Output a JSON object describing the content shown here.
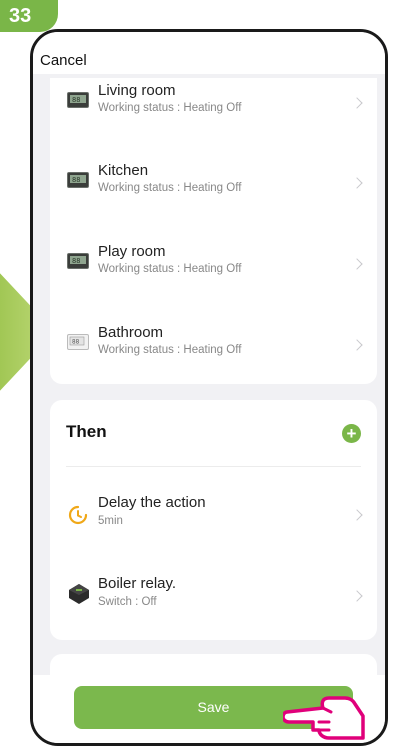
{
  "step_badge": "33",
  "header": {
    "cancel_label": "Cancel"
  },
  "if_devices": [
    {
      "name": "Living room",
      "status": "Working status : Heating Off",
      "display": "88"
    },
    {
      "name": "Kitchen",
      "status": "Working status : Heating Off",
      "display": "88"
    },
    {
      "name": "Play room",
      "status": "Working status : Heating Off",
      "display": "88"
    },
    {
      "name": "Bathroom",
      "status": "Working status : Heating Off",
      "display": "88"
    }
  ],
  "then": {
    "title": "Then",
    "add_icon": "plus-circle-icon",
    "actions": [
      {
        "title": "Delay the action",
        "sub": "5min",
        "icon": "timer-icon"
      },
      {
        "title": "Boiler relay.",
        "sub": "Switch : Off",
        "icon": "relay-icon"
      }
    ]
  },
  "footer": {
    "save_label": "Save"
  },
  "colors": {
    "accent": "#7ab648",
    "save": "#7bb84d",
    "pointer": "#e0007a",
    "timer": "#f0a818"
  }
}
